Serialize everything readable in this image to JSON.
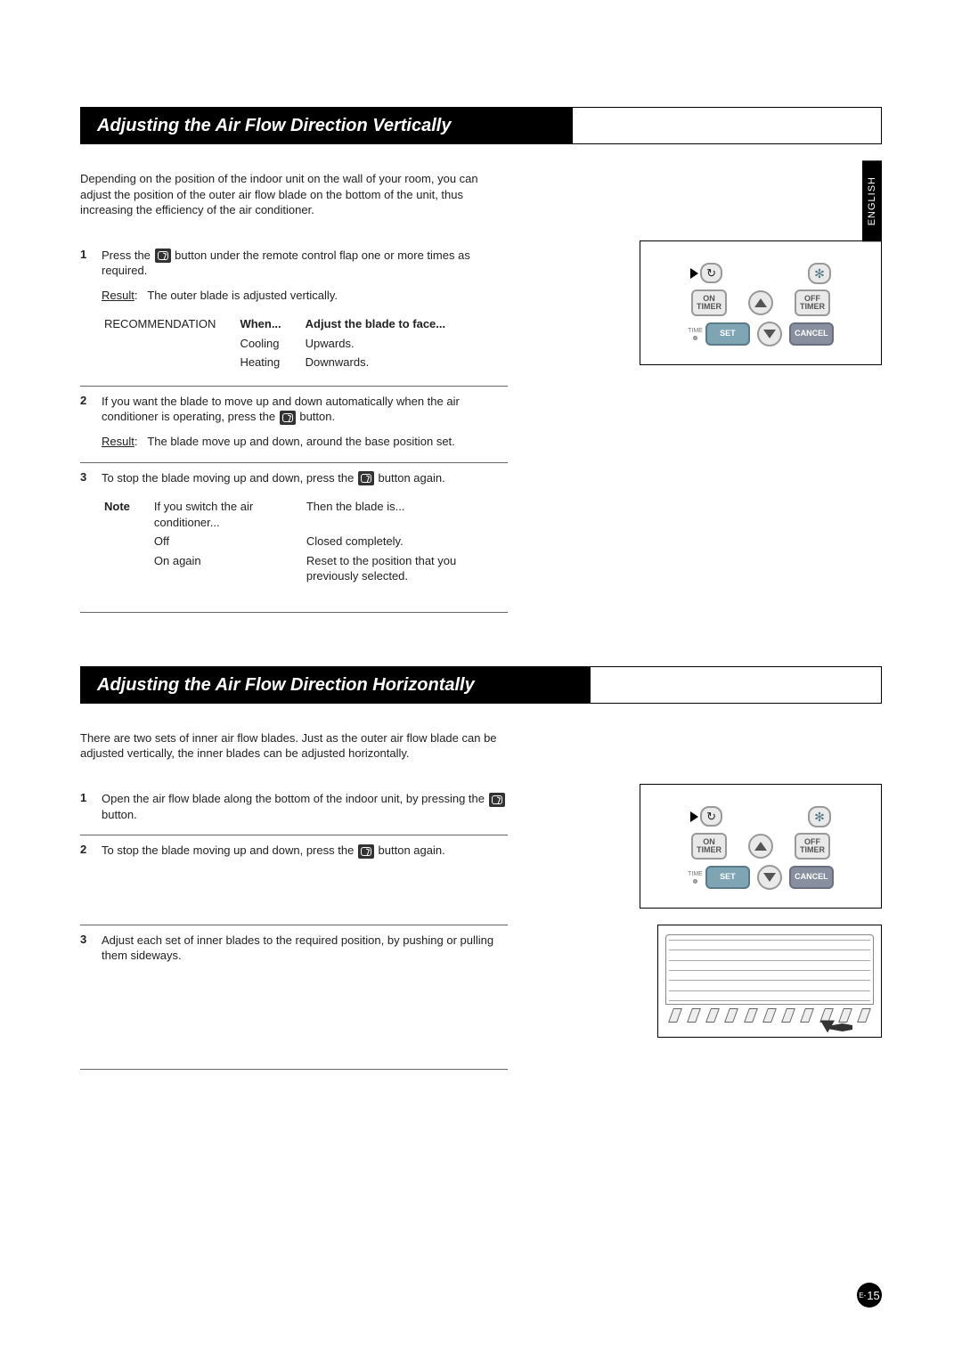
{
  "lang_tab": "ENGLISH",
  "page_number": {
    "prefix": "E-",
    "num": "15"
  },
  "icons": {
    "swing_name": "air-swing-icon",
    "fan_name": "fan-icon",
    "up_name": "arrow-up-icon",
    "down_name": "arrow-down-icon"
  },
  "remote": {
    "on_timer_l1": "ON",
    "on_timer_l2": "TIMER",
    "off_timer_l1": "OFF",
    "off_timer_l2": "TIMER",
    "set": "SET",
    "cancel": "CANCEL",
    "time": "TIME"
  },
  "sec1": {
    "title": "Adjusting the Air Flow Direction Vertically",
    "intro": "Depending on the position of the indoor unit on the wall of your room, you can adjust the position of the outer air flow blade on the bottom of the unit, thus increasing the efficiency of the air conditioner.",
    "step1": {
      "pre": "Press the ",
      "post": " button under the remote control flap one or more times as required.",
      "result_label": "Result",
      "result_text": "The outer blade is adjusted vertically.",
      "rec_label": "RECOMMENDATION",
      "when_h": "When...",
      "adjust_h": "Adjust the blade to face...",
      "when_1": "Cooling",
      "adjust_1": "Upwards.",
      "when_2": "Heating",
      "adjust_2": "Downwards."
    },
    "step2": {
      "pre": "If you want the blade to move up and down automatically when the air conditioner is operating, press the ",
      "post": " button.",
      "result_label": "Result",
      "result_text": "The blade move up and down, around the base position set."
    },
    "step3": {
      "pre": "To stop the blade moving up and down, press the ",
      "post": " button again.",
      "note_label": "Note",
      "col1_h": "If you switch the air conditioner...",
      "col2_h": "Then the blade is...",
      "row1_c1": "Off",
      "row1_c2": "Closed completely.",
      "row2_c1": "On again",
      "row2_c2": "Reset to the position that you previously selected."
    }
  },
  "sec2": {
    "title": "Adjusting the Air Flow Direction Horizontally",
    "intro": "There are two sets of inner air flow blades. Just as the outer air flow blade can be adjusted vertically, the inner blades can be adjusted horizontally.",
    "step1": {
      "pre": "Open the air flow blade along the bottom of the indoor unit, by pressing the ",
      "post": " button."
    },
    "step2": {
      "pre": "To stop the blade moving up and down, press the ",
      "post": " button again."
    },
    "step3": {
      "text": "Adjust each set of inner blades to the required position, by pushing or pulling them sideways."
    }
  }
}
